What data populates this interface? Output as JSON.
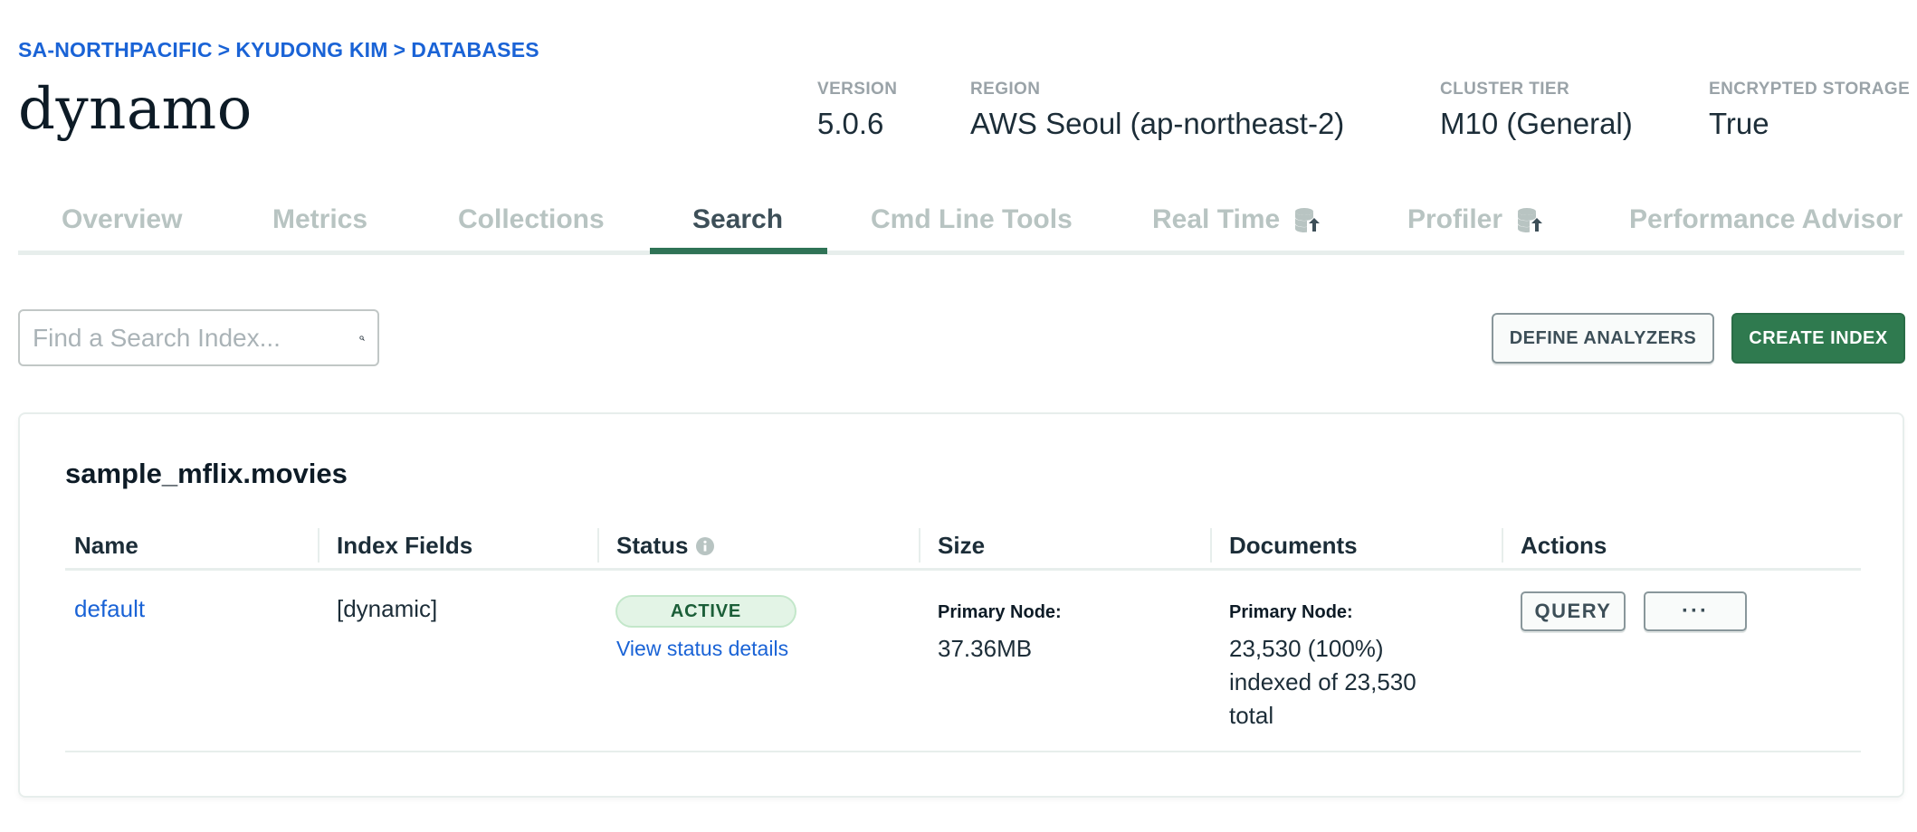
{
  "breadcrumb": {
    "org": "SA-NORTHPACIFIC",
    "project": "KYUDONG KIM",
    "section": "DATABASES",
    "separator": ">"
  },
  "cluster": {
    "name": "dynamo",
    "version_label": "VERSION",
    "version": "5.0.6",
    "region_label": "REGION",
    "region": "AWS Seoul (ap-northeast-2)",
    "tier_label": "CLUSTER TIER",
    "tier": "M10 (General)",
    "storage_label": "ENCRYPTED STORAGE",
    "storage": "True"
  },
  "tabs": [
    {
      "label": "Overview",
      "active": false
    },
    {
      "label": "Metrics",
      "active": false
    },
    {
      "label": "Collections",
      "active": false
    },
    {
      "label": "Search",
      "active": true
    },
    {
      "label": "Cmd Line Tools",
      "active": false
    },
    {
      "label": "Real Time",
      "active": false,
      "icon": "database-upgrade-icon"
    },
    {
      "label": "Profiler",
      "active": false,
      "icon": "database-upgrade-icon"
    },
    {
      "label": "Performance Advisor",
      "active": false
    }
  ],
  "search": {
    "placeholder": "Find a Search Index...",
    "value": ""
  },
  "actions": {
    "define_analyzers": "DEFINE ANALYZERS",
    "create_index": "CREATE INDEX"
  },
  "index_group": {
    "namespace": "sample_mflix.movies",
    "columns": {
      "name": "Name",
      "fields": "Index Fields",
      "status": "Status",
      "size": "Size",
      "documents": "Documents",
      "actions": "Actions"
    },
    "rows": [
      {
        "name": "default",
        "fields": "[dynamic]",
        "status": "ACTIVE",
        "status_link": "View status details",
        "size_label": "Primary Node:",
        "size": "37.36MB",
        "documents_label": "Primary Node:",
        "documents_line1": "23,530 (100%)",
        "documents_line2": "indexed of 23,530",
        "documents_line3": "total",
        "query_label": "QUERY",
        "more_label": "···"
      }
    ]
  },
  "colors": {
    "accent_link": "#1a63d6",
    "primary_green": "#2f7a4f",
    "active_tab_underline": "#2f7356",
    "status_bg": "#e3f4e6"
  }
}
